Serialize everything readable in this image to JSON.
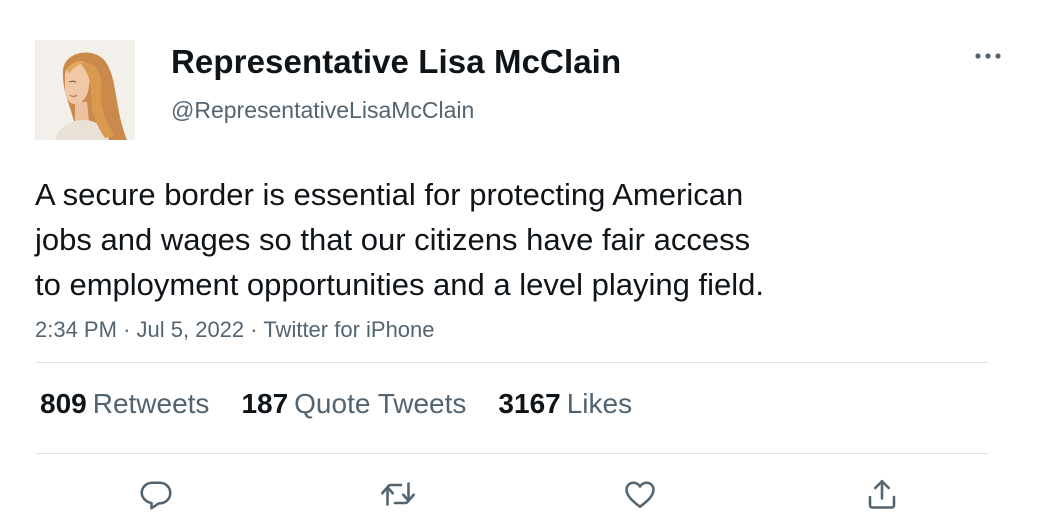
{
  "tweet": {
    "author": {
      "display_name": "Representative Lisa McClain",
      "handle": "@RepresentativeLisaMcClain"
    },
    "text_lines": [
      "A secure border is essential for protecting American",
      "jobs and wages so that our citizens have fair access",
      "to employment opportunities and a level playing field."
    ],
    "meta": {
      "time": "2:34 PM",
      "separator": "·",
      "date": "Jul 5, 2022",
      "source": "Twitter for iPhone"
    },
    "stats": {
      "retweets": {
        "count": "809",
        "label": "Retweets"
      },
      "quotes": {
        "count": "187",
        "label": "Quote Tweets"
      },
      "likes": {
        "count": "3167",
        "label": "Likes"
      }
    },
    "actions": [
      {
        "icon": "reply-icon"
      },
      {
        "icon": "retweet-icon"
      },
      {
        "icon": "like-icon"
      },
      {
        "icon": "share-icon"
      }
    ],
    "more_icon": "more-options-icon"
  },
  "colors": {
    "text_primary": "#0f1419",
    "text_secondary": "#536471",
    "divider": "#dfe3e6",
    "icon": "#536471"
  }
}
